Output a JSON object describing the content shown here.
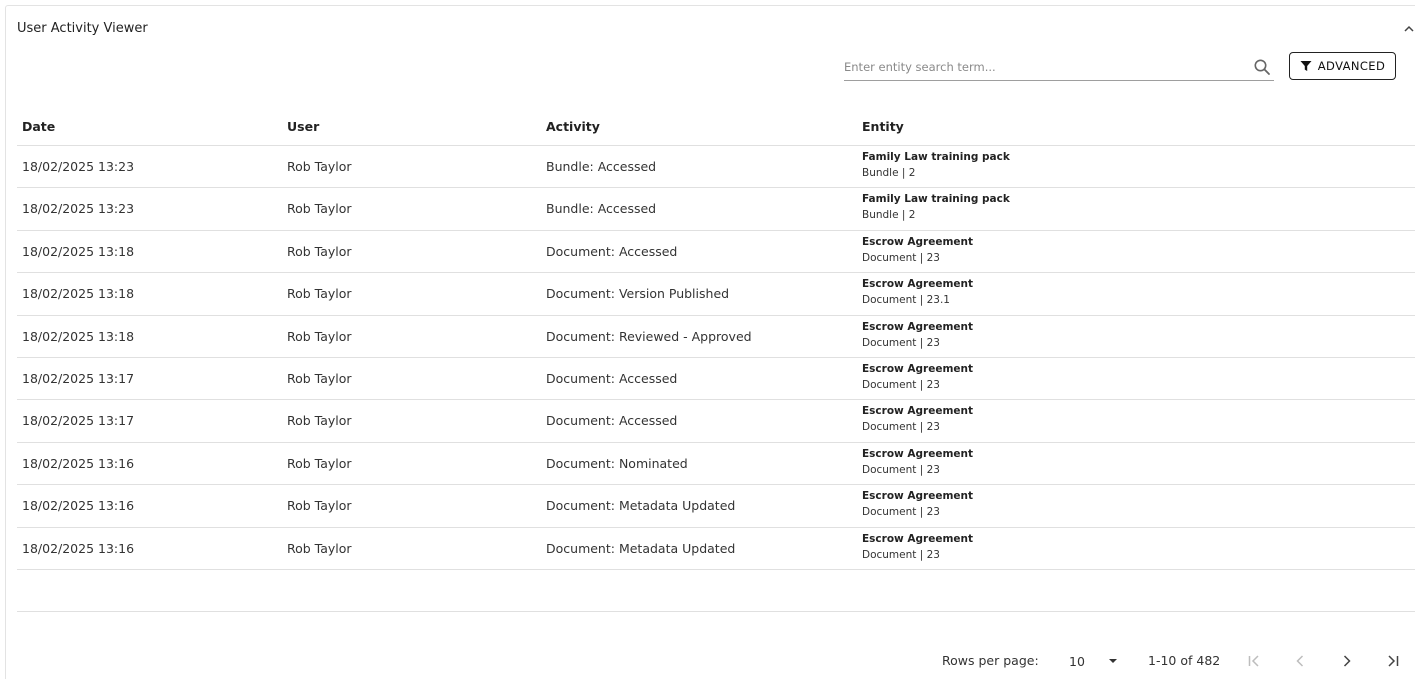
{
  "panel": {
    "title": "User Activity Viewer"
  },
  "search": {
    "placeholder": "Enter entity search term..."
  },
  "advanced_button": {
    "label": "ADVANCED"
  },
  "table": {
    "headers": {
      "date": "Date",
      "user": "User",
      "activity": "Activity",
      "entity": "Entity"
    },
    "rows": [
      {
        "date": "18/02/2025 13:23",
        "user": "Rob Taylor",
        "activity": "Bundle: Accessed",
        "entity_name": "Family Law training pack",
        "entity_sub": "Bundle | 2"
      },
      {
        "date": "18/02/2025 13:23",
        "user": "Rob Taylor",
        "activity": "Bundle: Accessed",
        "entity_name": "Family Law training pack",
        "entity_sub": "Bundle | 2"
      },
      {
        "date": "18/02/2025 13:18",
        "user": "Rob Taylor",
        "activity": "Document: Accessed",
        "entity_name": "Escrow Agreement",
        "entity_sub": "Document | 23"
      },
      {
        "date": "18/02/2025 13:18",
        "user": "Rob Taylor",
        "activity": "Document: Version Published",
        "entity_name": "Escrow Agreement",
        "entity_sub": "Document | 23.1"
      },
      {
        "date": "18/02/2025 13:18",
        "user": "Rob Taylor",
        "activity": "Document: Reviewed - Approved",
        "entity_name": "Escrow Agreement",
        "entity_sub": "Document | 23"
      },
      {
        "date": "18/02/2025 13:17",
        "user": "Rob Taylor",
        "activity": "Document: Accessed",
        "entity_name": "Escrow Agreement",
        "entity_sub": "Document | 23"
      },
      {
        "date": "18/02/2025 13:17",
        "user": "Rob Taylor",
        "activity": "Document: Accessed",
        "entity_name": "Escrow Agreement",
        "entity_sub": "Document | 23"
      },
      {
        "date": "18/02/2025 13:16",
        "user": "Rob Taylor",
        "activity": "Document: Nominated",
        "entity_name": "Escrow Agreement",
        "entity_sub": "Document | 23"
      },
      {
        "date": "18/02/2025 13:16",
        "user": "Rob Taylor",
        "activity": "Document: Metadata Updated",
        "entity_name": "Escrow Agreement",
        "entity_sub": "Document | 23"
      },
      {
        "date": "18/02/2025 13:16",
        "user": "Rob Taylor",
        "activity": "Document: Metadata Updated",
        "entity_name": "Escrow Agreement",
        "entity_sub": "Document | 23"
      }
    ]
  },
  "pagination": {
    "rows_per_page_label": "Rows per page:",
    "rows_per_page_value": "10",
    "range_text": "1-10 of 482"
  },
  "icons": {
    "collapse": "chevron-up-icon",
    "search": "search-icon",
    "filter": "filter-icon",
    "rows_dropdown": "caret-down-icon",
    "first": "first-page-icon",
    "prev": "chevron-left-icon",
    "next": "chevron-right-icon",
    "last": "last-page-icon"
  }
}
